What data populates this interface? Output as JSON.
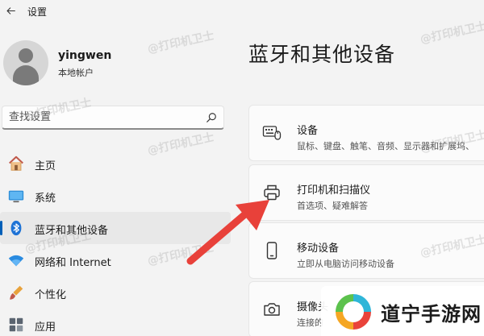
{
  "window": {
    "title": "设置"
  },
  "user": {
    "name": "yingwen",
    "account_type": "本地帐户"
  },
  "search": {
    "placeholder": "查找设置"
  },
  "nav": {
    "items": [
      {
        "label": "主页",
        "icon": "home-icon",
        "active": false
      },
      {
        "label": "系统",
        "icon": "system-icon",
        "active": false
      },
      {
        "label": "蓝牙和其他设备",
        "icon": "bluetooth-icon",
        "active": true
      },
      {
        "label": "网络和 Internet",
        "icon": "wifi-icon",
        "active": false
      },
      {
        "label": "个性化",
        "icon": "brush-icon",
        "active": false
      },
      {
        "label": "应用",
        "icon": "apps-icon",
        "active": false
      }
    ]
  },
  "main": {
    "title": "蓝牙和其他设备",
    "cards": [
      {
        "title": "设备",
        "subtitle": "鼠标、键盘、触笔、音频、显示器和扩展坞、",
        "icon": "devices-icon"
      },
      {
        "title": "打印机和扫描仪",
        "subtitle": "首选项、疑难解答",
        "icon": "printer-icon"
      },
      {
        "title": "移动设备",
        "subtitle": "立即从电脑访问移动设备",
        "icon": "phone-icon"
      },
      {
        "title": "摄像头",
        "subtitle": "连接的",
        "icon": "camera-icon"
      }
    ]
  },
  "watermark": {
    "text": "@打印机卫士"
  },
  "brand": {
    "text": "道宁手游网"
  },
  "colors": {
    "accent": "#005fb8",
    "arrow": "#e8413a"
  }
}
